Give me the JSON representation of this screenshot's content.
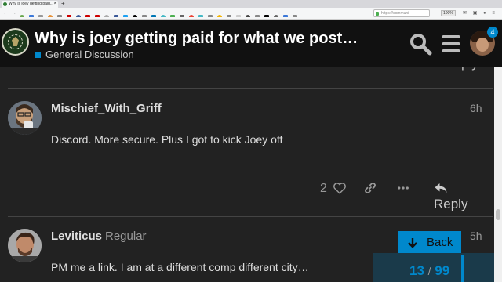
{
  "browser": {
    "tab_title": "Why is joey getting paid...",
    "new_tab": "+",
    "url": "https://communi",
    "zoom": "100%",
    "bookmark_colors": [
      "#6aa84f",
      "#3c78d8",
      "#999999",
      "#e69138",
      "#888888",
      "#cc0000",
      "#3b5998",
      "#cc0000",
      "#cc0000",
      "#aaaaaa",
      "#3b5998",
      "#1da1f2",
      "#000000",
      "#888888",
      "#0077b5",
      "#45b8c4",
      "#4caf50",
      "#666666",
      "#ea4335",
      "#45b8c4",
      "#888888",
      "#f4b400",
      "#888888",
      "#cccccc",
      "#444444",
      "#888888",
      "#000000",
      "#666666",
      "#3c78d8",
      "#888888"
    ]
  },
  "header": {
    "title": "Why is joey getting paid for what we post…",
    "category": "General Discussion",
    "category_color": "#0088cc",
    "notification_count": "4"
  },
  "previous_post": {
    "reply_label": "ply"
  },
  "posts": [
    {
      "username": "Mischief_With_Griff",
      "user_title": "",
      "time": "6h",
      "body": "Discord. More secure. Plus I got to kick Joey off",
      "like_count": "2",
      "reply_label": "Reply"
    },
    {
      "username": "Leviticus",
      "user_title": "Regular",
      "time": "5h",
      "body": "PM me a link. I am at a different comp different city…"
    }
  ],
  "timeline": {
    "back_label": "Back",
    "current": "13",
    "separator": "/",
    "total": "99",
    "accent": "#0088cc"
  }
}
